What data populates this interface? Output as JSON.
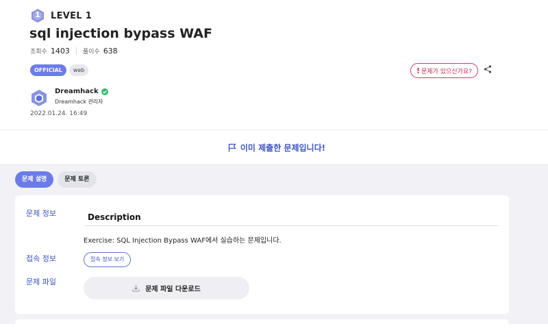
{
  "header": {
    "level_number": "1",
    "level_label": "LEVEL 1",
    "title": "sql injection bypass WAF",
    "views_label": "조회수",
    "views": "1403",
    "solves_label": "풀이수",
    "solves": "638",
    "tags": [
      "OFFICIAL",
      "web"
    ],
    "report_label": "문제가 있으신가요?",
    "report_icon_text": "!",
    "author_name": "Dreamhack",
    "author_role": "Dreamhack 관리자",
    "date": "2022.01.24. 16:49"
  },
  "status": {
    "submitted_message": "이미 제출한 문제입니다!"
  },
  "tabs": [
    {
      "label": "문제 설명",
      "active": true
    },
    {
      "label": "문제 토론",
      "active": false
    }
  ],
  "card": {
    "info_label": "문제 정보",
    "description_heading": "Description",
    "description_text": "Exercise: SQL Injection Bypass WAF에서 실습하는 문제입니다.",
    "connection_label": "접속 정보",
    "connection_button": "접속 정보 보기",
    "file_label": "문제 파일",
    "download_button": "문제 파일 다운로드"
  },
  "colors": {
    "accent": "#6b7ce9",
    "link_blue": "#3b52c7",
    "report_red": "#d23a63",
    "verified_green": "#2fbf71"
  }
}
